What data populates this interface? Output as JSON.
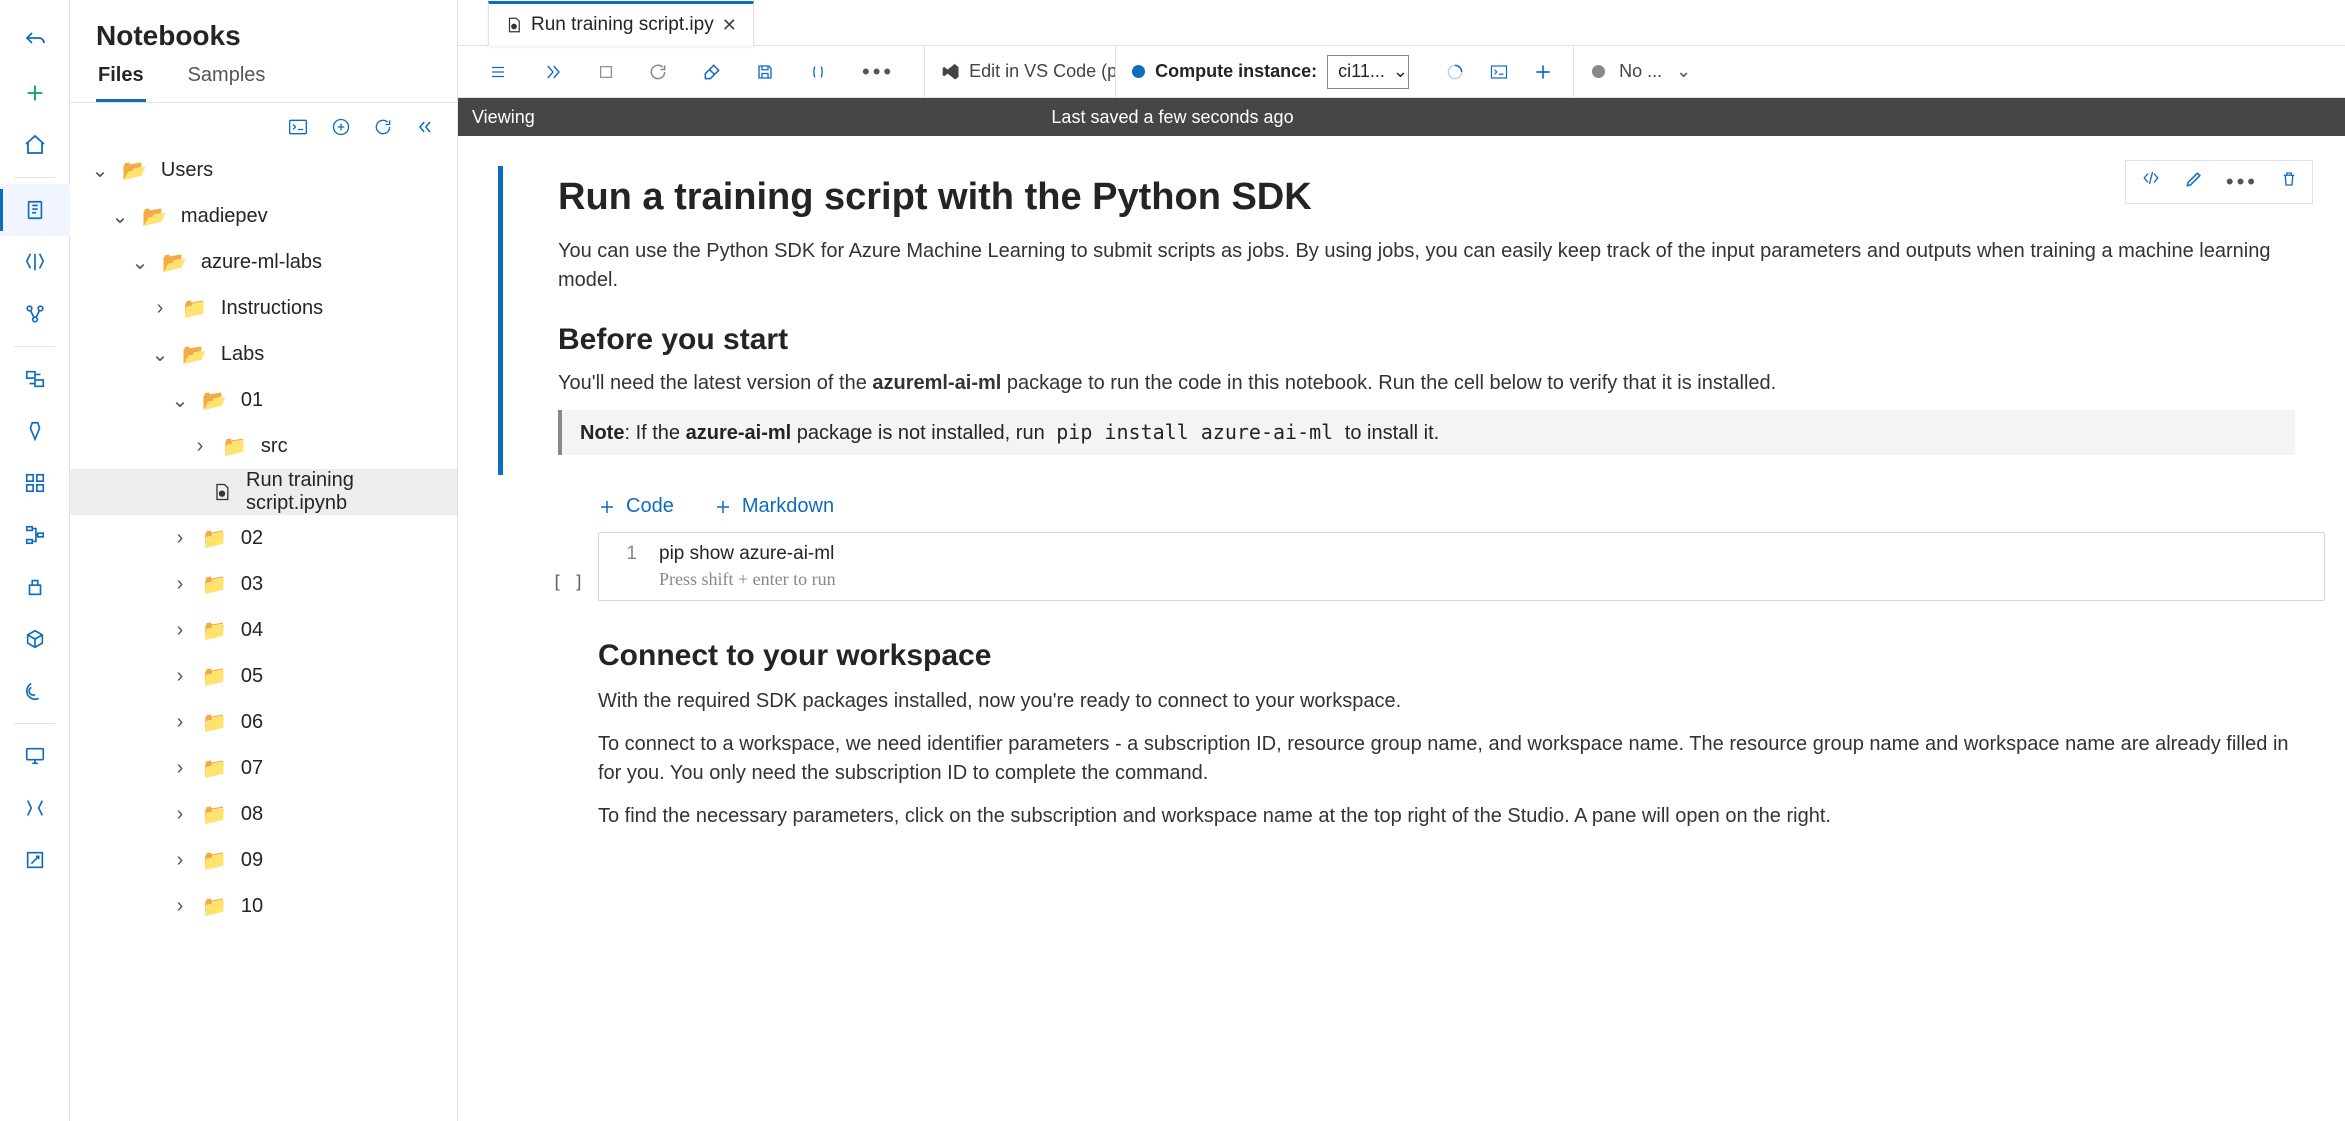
{
  "panel": {
    "title": "Notebooks"
  },
  "tabs": {
    "files": "Files",
    "samples": "Samples"
  },
  "tree": {
    "users": "Users",
    "user": "madiepev",
    "repo": "azure-ml-labs",
    "instructions": "Instructions",
    "labs": "Labs",
    "lab01": "01",
    "src": "src",
    "file": "Run training script.ipynb",
    "lab02": "02",
    "lab03": "03",
    "lab04": "04",
    "lab05": "05",
    "lab06": "06",
    "lab07": "07",
    "lab08": "08",
    "lab09": "09",
    "lab10": "10"
  },
  "doctab": {
    "name": "Run training script.ipy"
  },
  "editbar": {
    "vscode": "Edit in VS Code (pr...",
    "compute_label": "Compute instance:",
    "compute_value": "ci11...",
    "kernel": "No ..."
  },
  "savebar": {
    "mode": "Viewing",
    "status": "Last saved a few seconds ago"
  },
  "md": {
    "h1": "Run a training script with the Python SDK",
    "p1": "You can use the Python SDK for Azure Machine Learning to submit scripts as jobs. By using jobs, you can easily keep track of the input parameters and outputs when training a machine learning model.",
    "h2a": "Before you start",
    "p2a": "You'll need the latest version of the ",
    "p2b": "azureml-ai-ml",
    "p2c": " package to run the code in this notebook. Run the cell below to verify that it is installed.",
    "note_a": "Note",
    "note_b": ": If the ",
    "note_c": "azure-ai-ml",
    "note_d": " package is not installed, run ",
    "note_e": "pip install azure-ai-ml",
    "note_f": " to install it."
  },
  "add": {
    "code": "Code",
    "md": "Markdown"
  },
  "code": {
    "n": "1",
    "line": "pip show azure-ai-ml",
    "hint": "Press shift + enter to run",
    "bracket": "[ ]"
  },
  "md2": {
    "h2": "Connect to your workspace",
    "p1": "With the required SDK packages installed, now you're ready to connect to your workspace.",
    "p2": "To connect to a workspace, we need identifier parameters - a subscription ID, resource group name, and workspace name. The resource group name and workspace name are already filled in for you. You only need the subscription ID to complete the command.",
    "p3": "To find the necessary parameters, click on the subscription and workspace name at the top right of the Studio. A pane will open on the right."
  }
}
